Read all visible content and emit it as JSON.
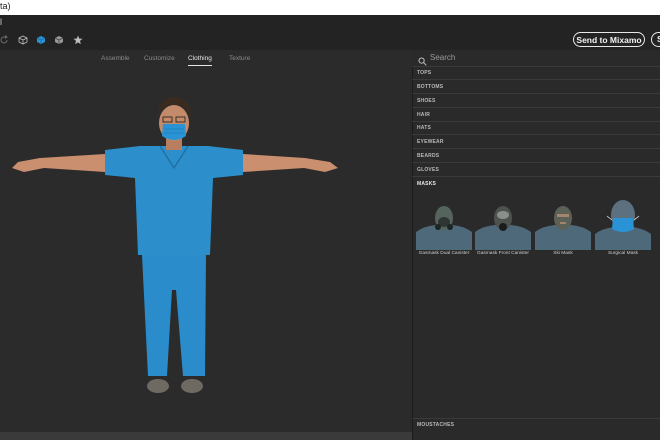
{
  "window": {
    "title": "ta)"
  },
  "menubar": {
    "text": "l"
  },
  "toolbar": {
    "icons": [
      "undo-icon",
      "cube-outline-icon",
      "cube-blue-icon",
      "cube-wire-icon",
      "star-icon"
    ],
    "send_label": "Send to Mixamo",
    "save_label": "S"
  },
  "tabs": [
    {
      "label": "Assemble",
      "active": false
    },
    {
      "label": "Customize",
      "active": false
    },
    {
      "label": "Clothing",
      "active": true
    },
    {
      "label": "Texture",
      "active": false
    }
  ],
  "search": {
    "placeholder": "Search"
  },
  "categories": [
    {
      "label": "TOPS"
    },
    {
      "label": "BOTTOMS"
    },
    {
      "label": "SHOES"
    },
    {
      "label": "HAIR"
    },
    {
      "label": "HATS"
    },
    {
      "label": "EYEWEAR"
    },
    {
      "label": "BEARDS"
    },
    {
      "label": "GLOVES"
    },
    {
      "label": "MASKS",
      "open": true
    },
    {
      "label": "MOUSTACHES"
    }
  ],
  "masks": [
    {
      "label": "Gasmask Dual Canister"
    },
    {
      "label": "Gasmask Front Canister"
    },
    {
      "label": "Ski Mask"
    },
    {
      "label": "Surgical Mask"
    }
  ],
  "colors": {
    "accent_blue": "#2a93d5",
    "scrubs": "#2c8fcc",
    "panel_bg": "#2a2a2a",
    "viewport_bg": "#2b2b2b"
  }
}
